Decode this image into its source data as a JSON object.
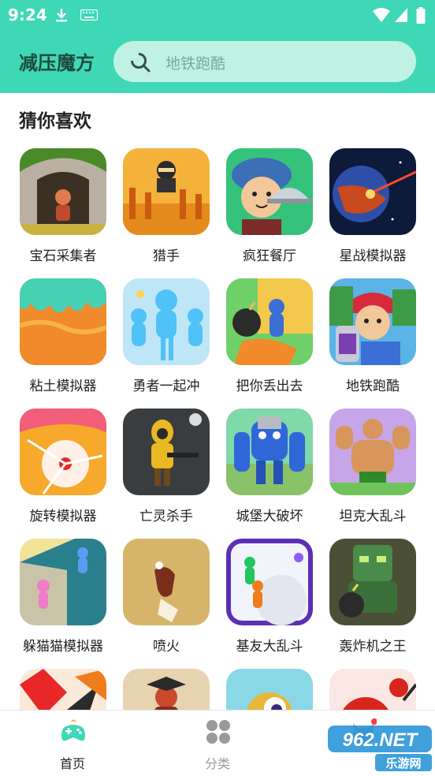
{
  "status": {
    "time": "9:24"
  },
  "header": {
    "title": "减压魔方",
    "search_placeholder": "地铁跑酷"
  },
  "section": {
    "title": "猜你喜欢"
  },
  "games": [
    {
      "label": "宝石采集者",
      "icon": "jungle-cave-icon"
    },
    {
      "label": "猎手",
      "icon": "ninja-icon"
    },
    {
      "label": "疯狂餐厅",
      "icon": "chef-icon"
    },
    {
      "label": "星战模拟器",
      "icon": "planet-icon"
    },
    {
      "label": "粘土模拟器",
      "icon": "clay-icon"
    },
    {
      "label": "勇者一起冲",
      "icon": "blue-runners-icon"
    },
    {
      "label": "把你丢出去",
      "icon": "bomb-throw-icon"
    },
    {
      "label": "地铁跑酷",
      "icon": "subway-runner-icon"
    },
    {
      "label": "旋转模拟器",
      "icon": "spinner-icon"
    },
    {
      "label": "亡灵杀手",
      "icon": "hazmat-gunner-icon"
    },
    {
      "label": "城堡大破坏",
      "icon": "blue-robot-icon"
    },
    {
      "label": "坦克大乱斗",
      "icon": "muscle-man-icon"
    },
    {
      "label": "躲猫猫模拟器",
      "icon": "hide-seek-icon"
    },
    {
      "label": "喷火",
      "icon": "fire-breath-icon"
    },
    {
      "label": "基友大乱斗",
      "icon": "snowball-icon"
    },
    {
      "label": "轰炸机之王",
      "icon": "bomber-icon"
    },
    {
      "label": "",
      "icon": "explosion-icon"
    },
    {
      "label": "",
      "icon": "warrior-icon"
    },
    {
      "label": "",
      "icon": "eye-ball-icon"
    },
    {
      "label": "",
      "icon": "red-blob-icon"
    }
  ],
  "tabs": [
    {
      "label": "首页",
      "icon": "gamepad-icon",
      "active": true
    },
    {
      "label": "分类",
      "icon": "category-grid-icon",
      "active": false
    },
    {
      "label": "",
      "icon": "cat-avatar-icon",
      "active": false
    }
  ],
  "watermark": {
    "line1": "962.NET",
    "line2": "乐游网"
  },
  "colors": {
    "accent": "#3fd8b6",
    "search_bg": "#bff2e5",
    "title_text": "#1e4a40"
  }
}
